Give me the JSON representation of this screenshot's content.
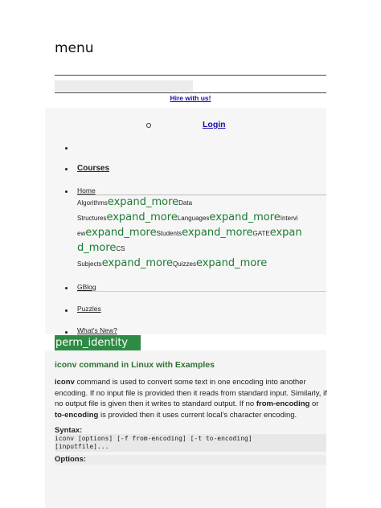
{
  "header": {
    "menu_label": "menu",
    "hire_link": "Hire with us!",
    "login_link": "Login"
  },
  "nav": {
    "courses": "Courses",
    "home": "Home",
    "submenu": {
      "algorithms": "Algorithms",
      "data_structures_a": "Data",
      "data_structures_b": "Structures",
      "languages": "Languages",
      "interview_a": "Intervi",
      "interview_b": "ew",
      "students": "Students",
      "gate": "GATE",
      "cs_subjects_a": "CS",
      "cs_subjects_b": "Subjects",
      "quizzes": "Quizzes",
      "expand": "expand_more",
      "expand_split_a": "expan",
      "expand_split_b": "d_more"
    },
    "gblog": "GBlog",
    "puzzles": "Puzzles",
    "whats_new": "What's New?"
  },
  "user_icon_label": "perm_identity",
  "article": {
    "title": "iconv command in Linux with Examples",
    "desc_1": "iconv",
    "desc_2": " command is used to convert some text in one encoding into another encoding. If no input file is provided then it reads from standard input. Similarly, if no output file is given then it writes to standard output. If no ",
    "desc_3": "from-encoding",
    "desc_4": " or ",
    "desc_5": "to-encoding",
    "desc_6": " is provided then it uses current local's character encoding.",
    "syntax_label": "Syntax:",
    "syntax_line_1": "iconv [options] [-f from-encoding] [-t to-encoding]",
    "syntax_line_2": "[inputfile]...",
    "options_label": "Options:"
  }
}
